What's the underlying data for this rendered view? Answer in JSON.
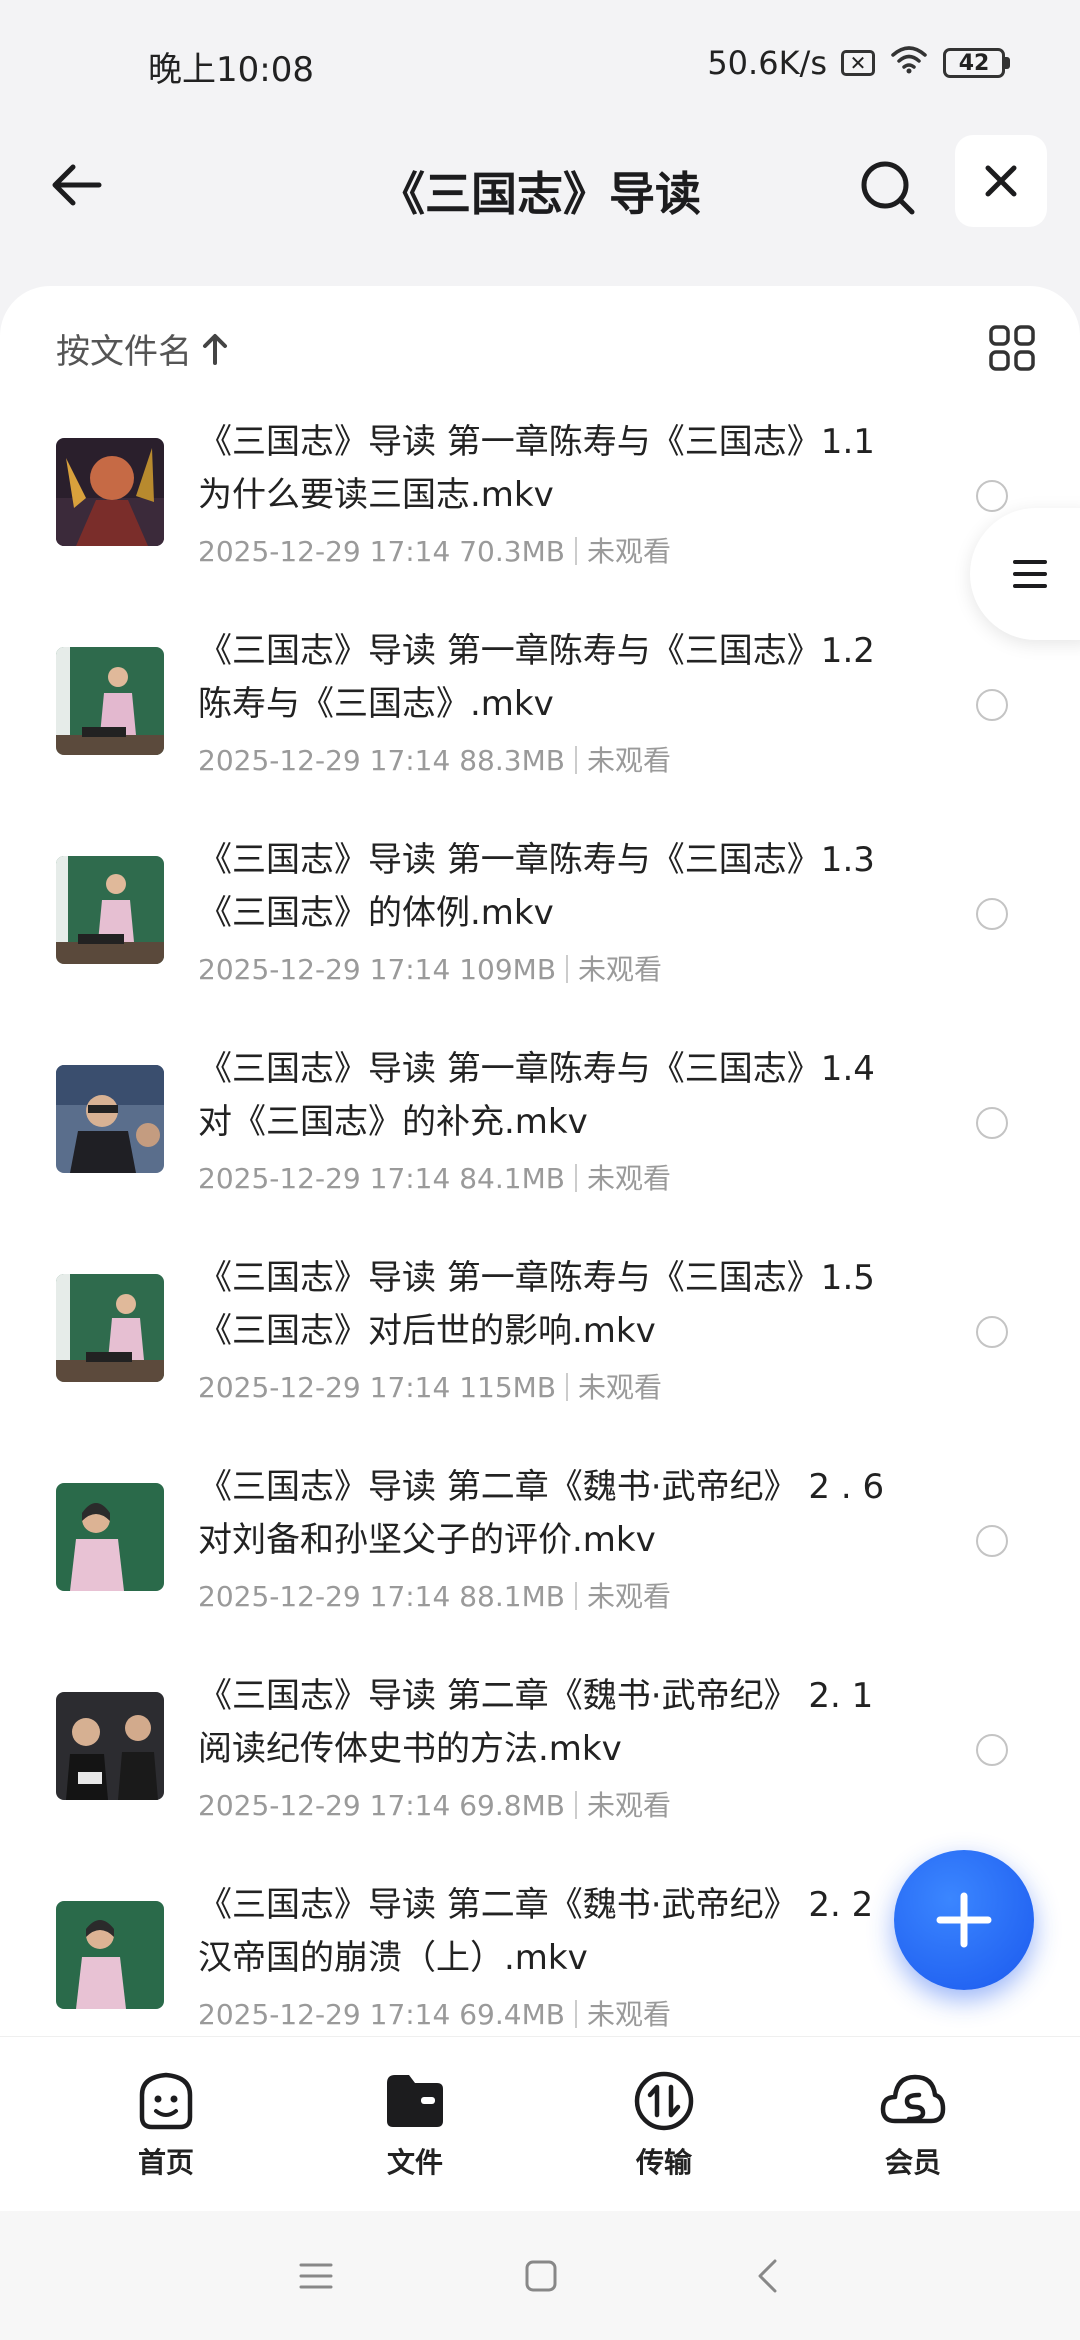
{
  "status_bar": {
    "time": "晚上10:08",
    "network_speed": "50.6K/s",
    "battery": "42"
  },
  "header": {
    "title": "《三国志》导读"
  },
  "toolbar": {
    "sort_label": "按文件名"
  },
  "files": [
    {
      "name": "《三国志》导读 第一章陈寿与《三国志》1.1为什么要读三国志.mkv",
      "date": "2025-12-29 17:14",
      "size": "70.3MB",
      "status": "未观看"
    },
    {
      "name": "《三国志》导读 第一章陈寿与《三国志》1.2陈寿与《三国志》.mkv",
      "date": "2025-12-29 17:14",
      "size": "88.3MB",
      "status": "未观看"
    },
    {
      "name": "《三国志》导读 第一章陈寿与《三国志》1.3《三国志》的体例.mkv",
      "date": "2025-12-29 17:14",
      "size": "109MB",
      "status": "未观看"
    },
    {
      "name": "《三国志》导读 第一章陈寿与《三国志》1.4对《三国志》的补充.mkv",
      "date": "2025-12-29 17:14",
      "size": "84.1MB",
      "status": "未观看"
    },
    {
      "name": "《三国志》导读 第一章陈寿与《三国志》1.5《三国志》对后世的影响.mkv",
      "date": "2025-12-29 17:14",
      "size": "115MB",
      "status": "未观看"
    },
    {
      "name": "《三国志》导读 第二章《魏书·武帝纪》 2 . 6对刘备和孙坚父子的评价.mkv",
      "date": "2025-12-29 17:14",
      "size": "88.1MB",
      "status": "未观看"
    },
    {
      "name": "《三国志》导读 第二章《魏书·武帝纪》 2. 1阅读纪传体史书的方法.mkv",
      "date": "2025-12-29 17:14",
      "size": "69.8MB",
      "status": "未观看"
    },
    {
      "name": "《三国志》导读 第二章《魏书·武帝纪》 2. 2汉帝国的崩溃（上）.mkv",
      "date": "2025-12-29 17:14",
      "size": "69.4MB",
      "status": "未观看"
    }
  ],
  "bottom_nav": {
    "home": "首页",
    "files": "文件",
    "transfer": "传输",
    "vip": "会员"
  },
  "colors": {
    "accent": "#1f5ff0",
    "background": "#f3f3f5"
  }
}
